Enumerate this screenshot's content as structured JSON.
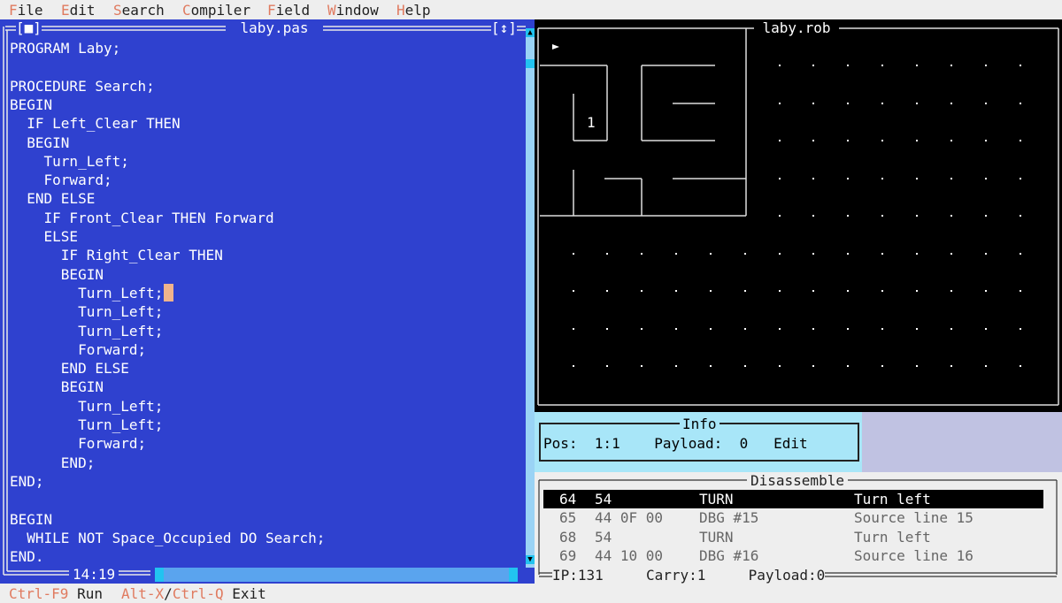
{
  "menu": [
    {
      "hotkey": "F",
      "rest": "ile"
    },
    {
      "hotkey": "E",
      "rest": "dit"
    },
    {
      "hotkey": "S",
      "rest": "earch"
    },
    {
      "hotkey": "C",
      "rest": "ompiler"
    },
    {
      "hotkey": "F",
      "rest": "ield"
    },
    {
      "hotkey": "W",
      "rest": "indow"
    },
    {
      "hotkey": "H",
      "rest": "elp"
    }
  ],
  "editor": {
    "title": "laby.pas",
    "close_glyph": "[■]",
    "zoom_glyph": "[↕]",
    "cursor_position": "14:19",
    "lines": [
      "PROGRAM Laby;",
      "",
      "PROCEDURE Search;",
      "BEGIN",
      "  IF Left_Clear THEN",
      "  BEGIN",
      "    Turn_Left;",
      "    Forward;",
      "  END ELSE",
      "    IF Front_Clear THEN Forward",
      "    ELSE",
      "      IF Right_Clear THEN",
      "      BEGIN",
      "        Turn_Left;",
      "        Turn_Left;",
      "        Turn_Left;",
      "        Forward;",
      "      END ELSE",
      "      BEGIN",
      "        Turn_Left;",
      "        Turn_Left;",
      "        Forward;",
      "      END;",
      "END;",
      "",
      "BEGIN",
      "  WHILE NOT Space_Occupied DO Search;",
      "END."
    ]
  },
  "field": {
    "title": "laby.rob",
    "robot_glyph": "►",
    "cell_marker": "1"
  },
  "info": {
    "title": "Info",
    "pos_label": "Pos:",
    "pos_value": "1:1",
    "payload_label": "Payload:",
    "payload_value": "0",
    "mode": "Edit"
  },
  "disassemble": {
    "title": "Disassemble",
    "rows": [
      {
        "addr": "64",
        "bytes": "54",
        "instr": "TURN",
        "comment": "Turn left",
        "selected": true
      },
      {
        "addr": "65",
        "bytes": "44 0F 00",
        "instr": "DBG #15",
        "comment": "Source line 15",
        "selected": false
      },
      {
        "addr": "68",
        "bytes": "54",
        "instr": "TURN",
        "comment": "Turn left",
        "selected": false
      },
      {
        "addr": "69",
        "bytes": "44 10 00",
        "instr": "DBG #16",
        "comment": "Source line 16",
        "selected": false
      }
    ],
    "ip": "IP:131",
    "carry": "Carry:1",
    "payload": "Payload:0"
  },
  "status": {
    "run_key": "Ctrl-F9",
    "run_label": "Run",
    "exit_key1": "Alt-X",
    "exit_sep": "/",
    "exit_key2": "Ctrl-Q",
    "exit_label": "Exit"
  },
  "colors": {
    "editor_bg": "#2f41cf",
    "menu_hotkey": "#e07a5f",
    "info_bg": "#a8e6f8",
    "cursor": "#f0b38c"
  }
}
